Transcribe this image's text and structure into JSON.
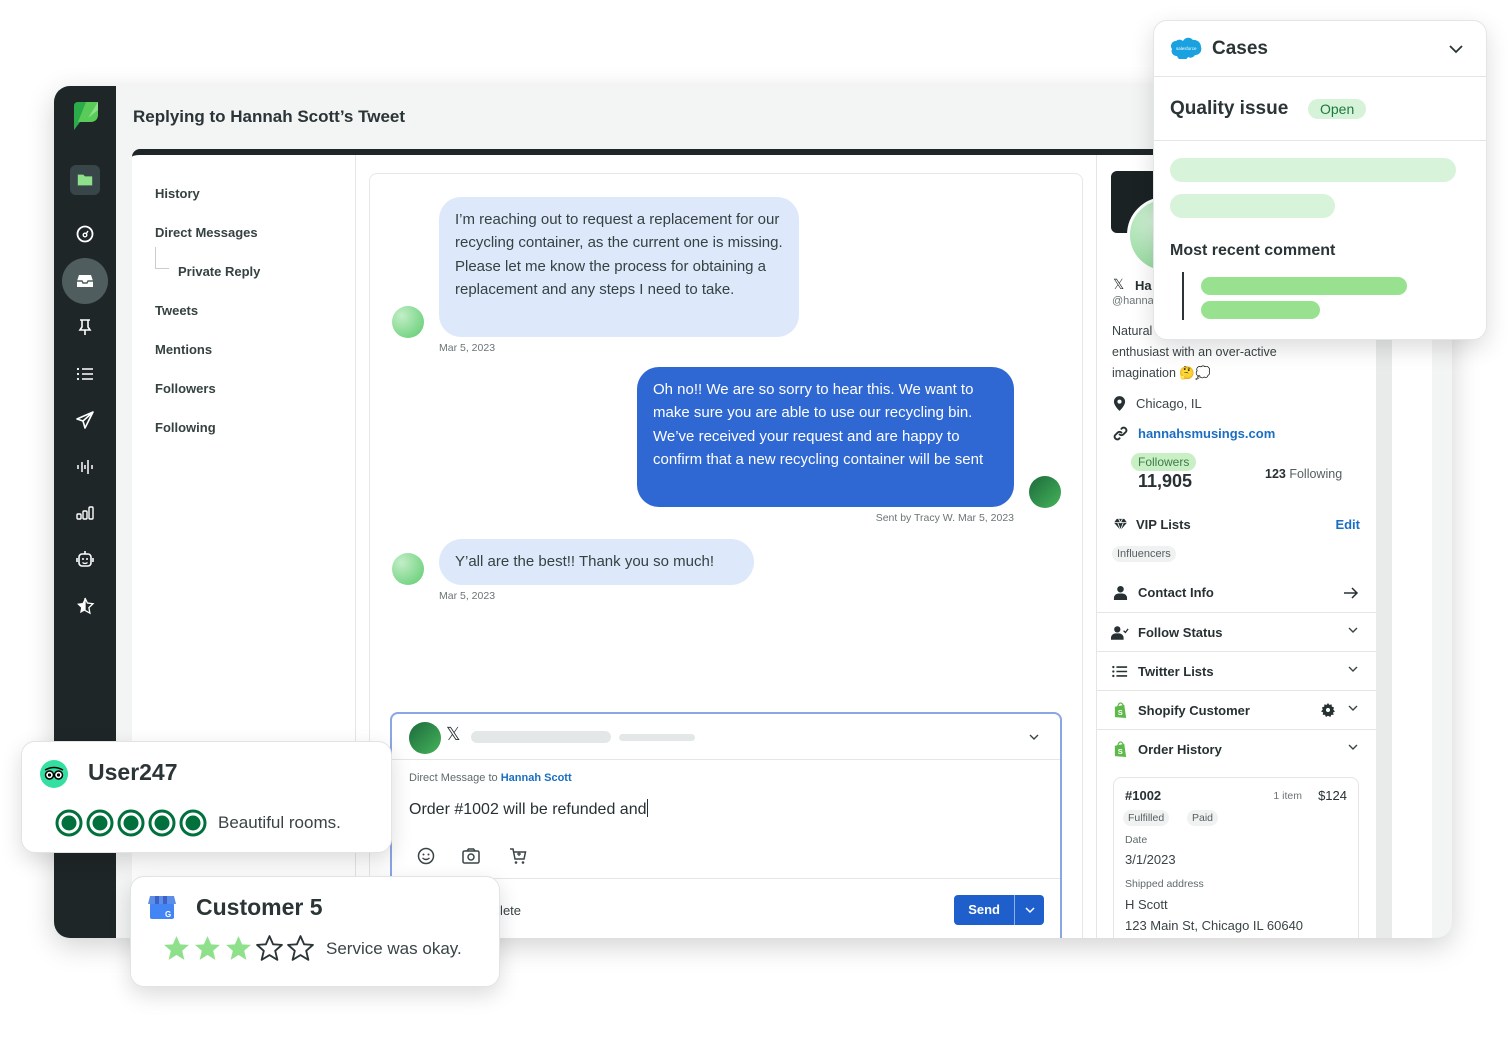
{
  "app": {
    "title": "Replying to Hannah Scott’s Tweet",
    "rail_icons": [
      "folder-icon",
      "gauge-icon",
      "inbox-icon",
      "pin-icon",
      "list-icon",
      "send-icon",
      "listening-icon",
      "reports-icon",
      "bot-icon",
      "star-icon"
    ]
  },
  "subnav": {
    "items": [
      {
        "label": "History"
      },
      {
        "label": "Direct Messages"
      },
      {
        "label": "Private Reply"
      },
      {
        "label": "Tweets"
      },
      {
        "label": "Mentions"
      },
      {
        "label": "Followers"
      },
      {
        "label": "Following"
      }
    ]
  },
  "conversation": {
    "messages": [
      {
        "direction": "incoming",
        "text": "I’m reaching out to request a replacement for our recycling container, as the current one is missing. Please let me know the process for obtaining a replacement and any steps I need to take.",
        "meta": "Mar 5, 2023"
      },
      {
        "direction": "outgoing",
        "text": "Oh no!! We are so sorry to hear this. We want to make sure you are able to use our recycling bin. We’ve received your request and are happy to confirm that a new recycling container will be sent",
        "meta": "Sent by Tracy W. Mar 5, 2023"
      },
      {
        "direction": "incoming",
        "text": "Y’all are the best!! Thank you so much!",
        "meta": "Mar 5, 2023"
      }
    ]
  },
  "composer": {
    "network_glyph": "𝕏",
    "to_prefix": "Direct Message to",
    "to_name": "Hannah Scott",
    "text": "Order #1002 will be refunded and",
    "footer_text": "mplete",
    "send_label": "Send"
  },
  "profile": {
    "network_glyph": "𝕏",
    "name_partial": "Ha",
    "handle_partial": "@hanna",
    "bio_line1": "Natural",
    "bio_line2": "enthusiast with an over-active",
    "bio_line3": "imagination 🤔💭",
    "location": "Chicago, IL",
    "website": "hannahsmusings.com",
    "followers_label": "Followers",
    "followers_count": "11,905",
    "following_count": "123",
    "following_label": "Following",
    "vip_label": "VIP Lists",
    "vip_edit": "Edit",
    "vip_tag": "Influencers",
    "sections": [
      {
        "label": "Contact Info",
        "icon": "person-icon"
      },
      {
        "label": "Follow Status",
        "icon": "person-check-icon"
      },
      {
        "label": "Twitter Lists",
        "icon": "list-icon"
      },
      {
        "label": "Shopify Customer",
        "icon": "shopify-icon"
      },
      {
        "label": "Order History",
        "icon": "shopify-icon"
      }
    ],
    "order": {
      "number": "#1002",
      "items": "1 item",
      "total": "$124",
      "tags": [
        "Fulfilled",
        "Paid"
      ],
      "date_label": "Date",
      "date": "3/1/2023",
      "address_label": "Shipped address",
      "address_name": "H Scott",
      "address_line": "123 Main St, Chicago IL 60640"
    }
  },
  "cases": {
    "title": "Cases",
    "case_title": "Quality issue",
    "status": "Open",
    "comment_label": "Most recent comment",
    "colors": {
      "status_bg": "#d6f3d9",
      "status_text": "#1c7a3d",
      "skeleton_light": "#d7f3da",
      "skeleton_strong": "#98e18e"
    }
  },
  "reviews": [
    {
      "source": "tripadvisor",
      "user": "User247",
      "rating": 5,
      "max": 5,
      "text": "Beautiful rooms."
    },
    {
      "source": "google-business",
      "user": "Customer 5",
      "rating": 3,
      "max": 5,
      "text": "Service was okay."
    }
  ],
  "colors": {
    "brand_green": "#59cb59",
    "rail_bg": "#1f2628",
    "outgoing_bubble": "#2f68d3",
    "incoming_bubble": "#dde9fb",
    "link": "#1b6ec2",
    "tripadvisor_green": "#00703c"
  }
}
